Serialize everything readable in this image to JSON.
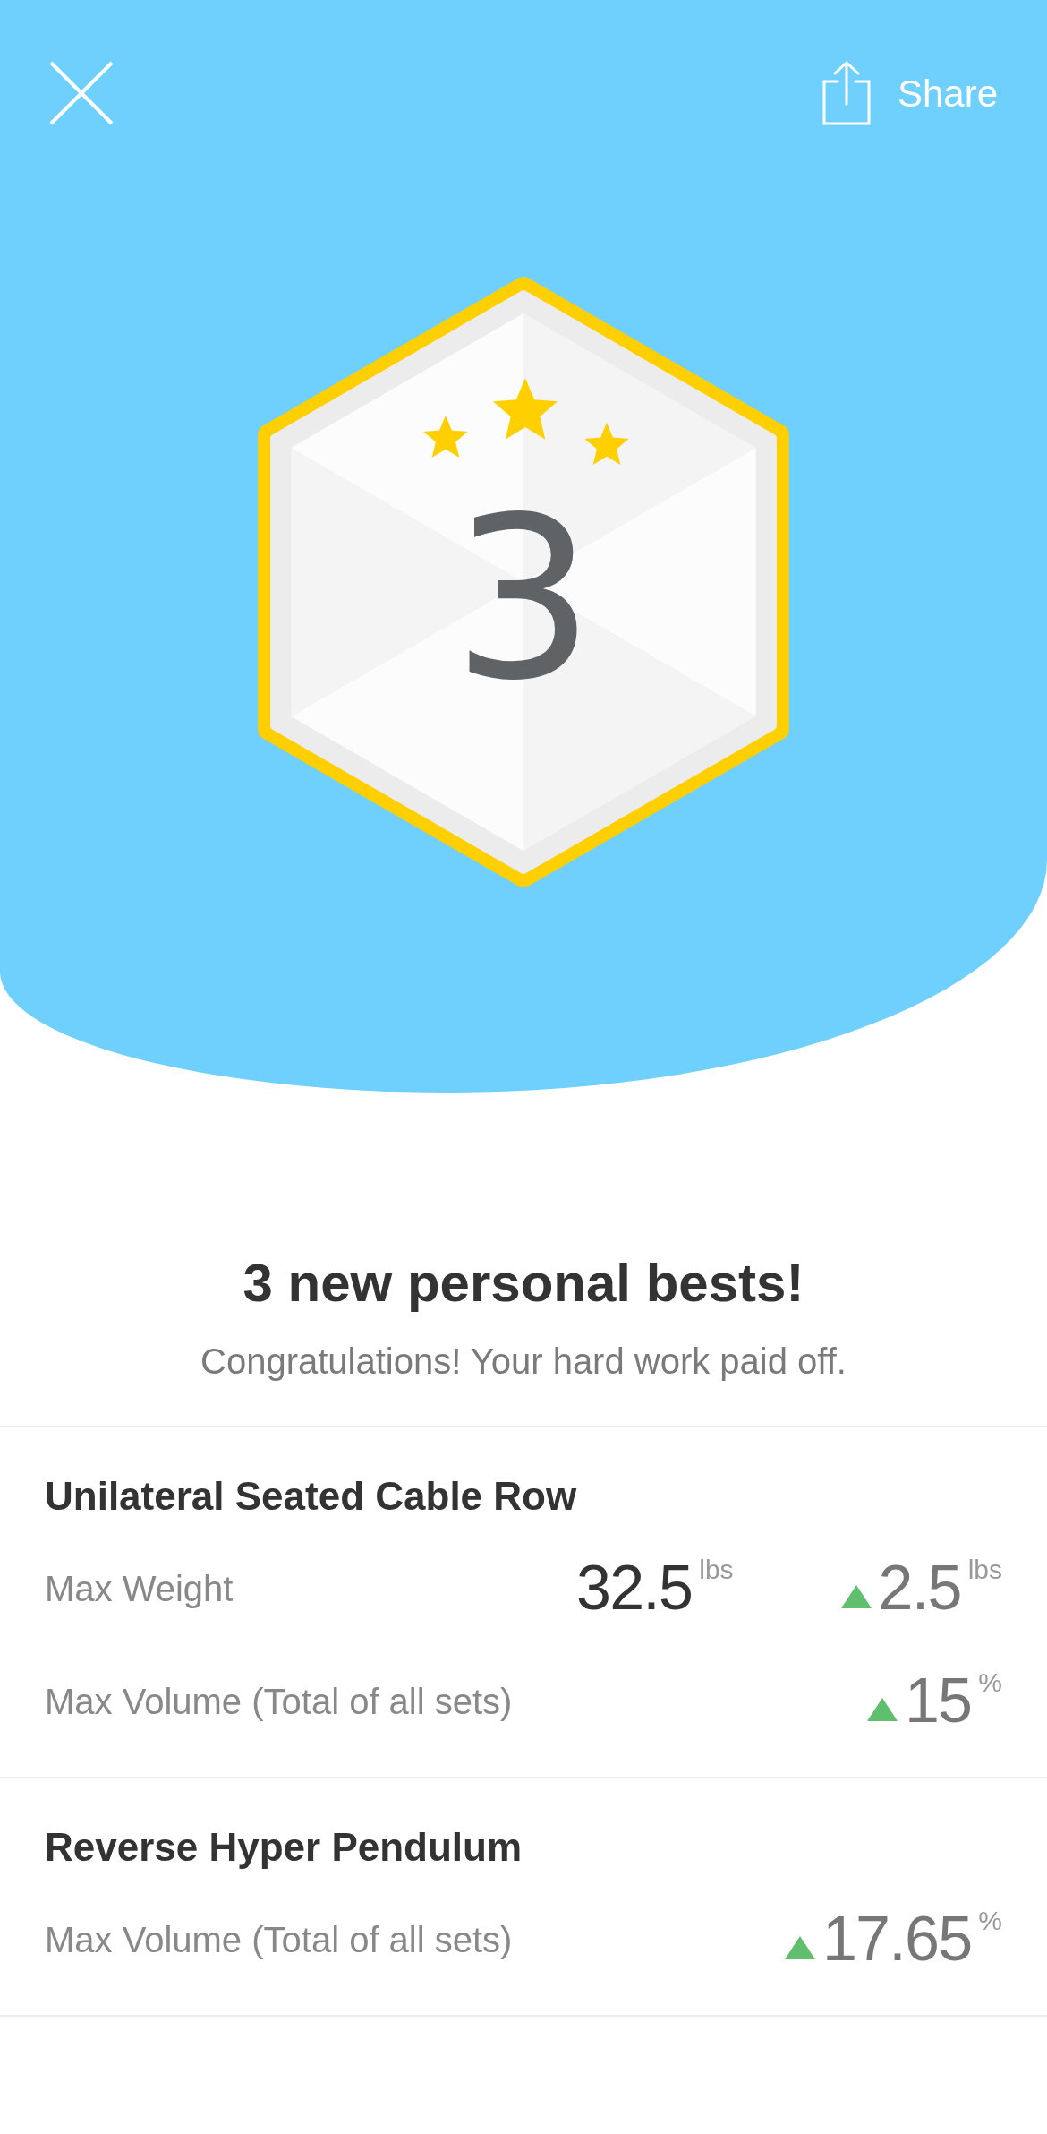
{
  "header": {
    "share_label": "Share"
  },
  "badge": {
    "number": "3"
  },
  "title": "3 new personal bests!",
  "subtitle": "Congratulations! Your hard work paid off.",
  "exercises": [
    {
      "name": "Unilateral Seated Cable Row",
      "rows": [
        {
          "label": "Max Weight",
          "value": {
            "number": "32.5",
            "unit": "lbs"
          },
          "change": {
            "kind": "increase",
            "number": "2.5",
            "unit": "lbs"
          }
        },
        {
          "label": "Max Volume (Total of all sets)",
          "change": {
            "kind": "increase",
            "number": "15",
            "unit": "%"
          }
        }
      ]
    },
    {
      "name": "Reverse Hyper Pendulum",
      "rows": [
        {
          "label": "Max Volume (Total of all sets)",
          "change": {
            "kind": "increase",
            "number": "17.65",
            "unit": "%"
          }
        }
      ]
    }
  ]
}
